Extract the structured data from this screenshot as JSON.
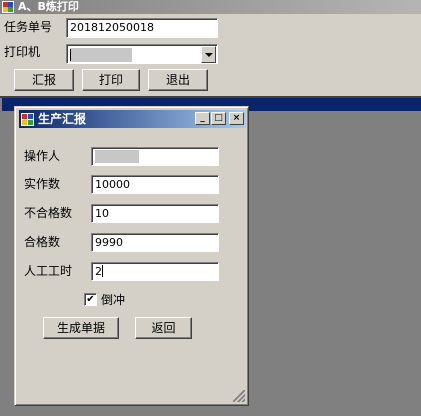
{
  "window": {
    "title": "A、B炼打印",
    "icon": "app-window-icon"
  },
  "form": {
    "task_label": "任务单号",
    "task_value": "201812050018",
    "printer_label": "打印机",
    "printer_value": ""
  },
  "toolbar": {
    "report_label": "汇报",
    "print_label": "打印",
    "exit_label": "退出"
  },
  "dialog": {
    "title": "生产汇报",
    "icon": "app-window-icon",
    "minimize_glyph": "_",
    "maximize_glyph": "□",
    "close_glyph": "×",
    "fields": {
      "operator_label": "操作人",
      "operator_value": "",
      "actual_label": "实作数",
      "actual_value": "10000",
      "defect_label": "不合格数",
      "defect_value": "10",
      "qualified_label": "合格数",
      "qualified_value": "9990",
      "hours_label": "人工工时",
      "hours_value": "2"
    },
    "reverse_label": "倒冲",
    "reverse_checked": true,
    "reverse_glyph": "✔",
    "generate_label": "生成单据",
    "back_label": "返回"
  },
  "colors": {
    "face": "#d4d0c8",
    "active_title": "#0a246a",
    "mdi_background": "#808080"
  }
}
